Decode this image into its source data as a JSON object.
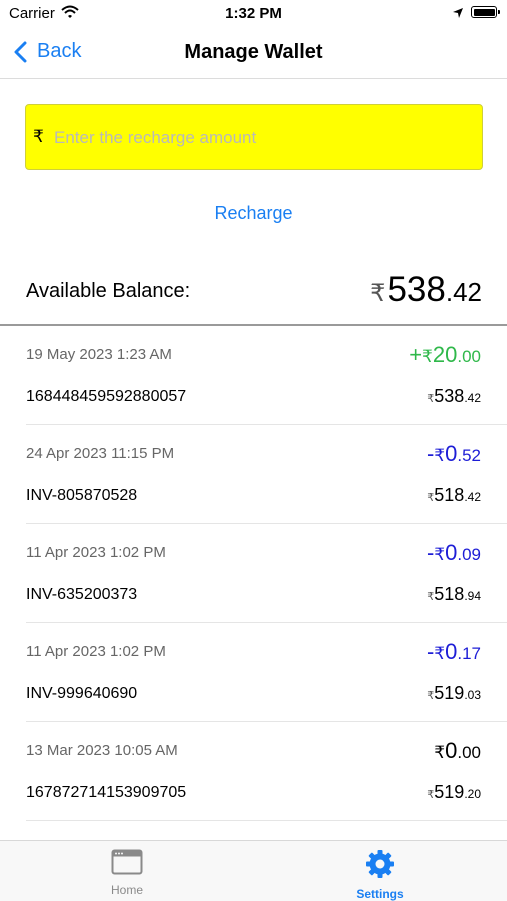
{
  "status_bar": {
    "carrier": "Carrier",
    "time": "1:32 PM"
  },
  "nav": {
    "back_label": "Back",
    "title": "Manage Wallet"
  },
  "recharge": {
    "currency_symbol": "₹",
    "placeholder": "Enter the recharge amount",
    "button_label": "Recharge"
  },
  "balance": {
    "label": "Available Balance:",
    "symbol": "₹",
    "int": "538",
    "dec": ".42"
  },
  "transactions": [
    {
      "date": "19 May 2023 1:23 AM",
      "ref": "168448459592880057",
      "sign": "+",
      "amount_int": "20",
      "amount_dec": ".00",
      "color": "#2fb84a",
      "balance_int": "538",
      "balance_dec": ".42"
    },
    {
      "date": "24 Apr 2023 11:15 PM",
      "ref": "INV-805870528",
      "sign": "-",
      "amount_int": "0",
      "amount_dec": ".52",
      "color": "#1d1dd6",
      "balance_int": "518",
      "balance_dec": ".42"
    },
    {
      "date": "11 Apr 2023 1:02 PM",
      "ref": "INV-635200373",
      "sign": "-",
      "amount_int": "0",
      "amount_dec": ".09",
      "color": "#1d1dd6",
      "balance_int": "518",
      "balance_dec": ".94"
    },
    {
      "date": "11 Apr 2023 1:02 PM",
      "ref": "INV-999640690",
      "sign": "-",
      "amount_int": "0",
      "amount_dec": ".17",
      "color": "#1d1dd6",
      "balance_int": "519",
      "balance_dec": ".03"
    },
    {
      "date": "13 Mar 2023 10:05 AM",
      "ref": "167872714153909705",
      "sign": "",
      "amount_int": "0",
      "amount_dec": ".00",
      "color": "#000000",
      "balance_int": "519",
      "balance_dec": ".20"
    }
  ],
  "tabbar": {
    "home_label": "Home",
    "settings_label": "Settings"
  },
  "colors": {
    "accent": "#1a7ff2",
    "input_bg": "#ffff00"
  }
}
